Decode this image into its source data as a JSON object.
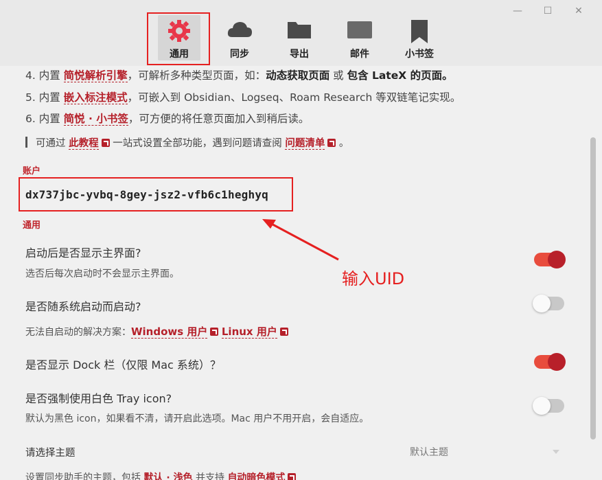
{
  "window": {
    "min_label": "—",
    "max_label": "☐",
    "close_label": "✕"
  },
  "tabs": [
    {
      "label": "通用",
      "icon": "gear-icon",
      "active": true
    },
    {
      "label": "同步",
      "icon": "cloud-icon"
    },
    {
      "label": "导出",
      "icon": "folder-icon"
    },
    {
      "label": "邮件",
      "icon": "mail-icon"
    },
    {
      "label": "小书签",
      "icon": "bookmark-icon"
    }
  ],
  "features": [
    {
      "prefix": "4. 内置 ",
      "link": "简悦解析引擎",
      "mid": "，可解析多种类型页面，如：",
      "strong1": "动态获取页面",
      "mid2": " 或 ",
      "strong2": "包含 LateX 的页面",
      "suffix": "。"
    },
    {
      "prefix": "5. 内置 ",
      "link": "嵌入标注模式",
      "suffix": "，可嵌入到 Obsidian、Logseq、Roam Research 等双链笔记实现。"
    },
    {
      "prefix": "6. 内置 ",
      "link": "简悦 · 小书签",
      "suffix": "，可方便的将任意页面加入到稍后读。"
    }
  ],
  "tip": {
    "prefix": "可通过 ",
    "link1": "此教程",
    "mid": " 一站式设置全部功能，遇到问题请查阅 ",
    "link2": "问题清单",
    "suffix": " 。"
  },
  "account": {
    "section_label": "账户",
    "uid": "dx737jbc-yvbq-8gey-jsz2-vfb6c1heghyq"
  },
  "general": {
    "section_label": "通用"
  },
  "options": [
    {
      "title": "启动后是否显示主界面?",
      "desc": "选否后每次启动时不会显示主界面。",
      "enabled": true
    },
    {
      "title": "是否随系统启动而启动?",
      "desc_prefix": "无法自启动的解决方案：",
      "link1": "Windows 用户",
      "link2": "Linux 用户",
      "enabled": false
    },
    {
      "title": "是否显示 Dock 栏（仅限 Mac 系统）？",
      "enabled": true
    },
    {
      "title": "是否强制使用白色 Tray icon?",
      "desc": "默认为黑色 icon，如果看不清，请开启此选项。Mac 用户不用开启，会自适应。",
      "enabled": false
    }
  ],
  "theme": {
    "label": "请选择主题",
    "value": "默认主题",
    "desc_prefix": "设置同步助手的主题，包括 ",
    "link1": "默认 · 浅色",
    "desc_mid": " 并支持 ",
    "link2": "自动暗色模式"
  },
  "annotation": "输入UID",
  "colors": {
    "accent": "#b5202a",
    "highlight": "#e52020",
    "toggle_on": "#e84c3d"
  }
}
